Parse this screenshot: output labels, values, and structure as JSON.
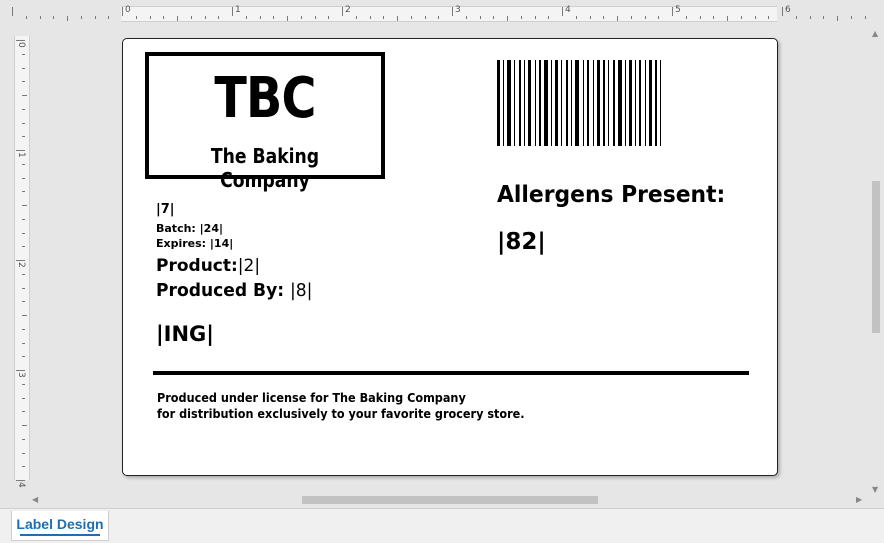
{
  "ruler": {
    "top_numbers": [
      "0",
      "1",
      "2",
      "3",
      "4",
      "5",
      "6"
    ],
    "left_numbers": [
      "0",
      "1",
      "2",
      "3",
      "4"
    ]
  },
  "label": {
    "logo_title": "TBC",
    "logo_subtitle": "The Baking Company",
    "field_7": "|7|",
    "batch": "Batch: |24|",
    "expires": "Expires: |14|",
    "product_label": "Product:",
    "product_value": "|2|",
    "produced_by_label": "Produced By: ",
    "produced_by_value": "|8|",
    "ing": "|ING|",
    "allergens_title": "Allergens Present:",
    "allergens_value": "|82|",
    "footer_line1": "Produced under license for The Baking Company",
    "footer_line2": "for distribution exclusively to your favorite grocery store."
  },
  "tabs": [
    {
      "label": "Label Design",
      "active": true
    }
  ],
  "colors": {
    "tab_accent": "#1f6fb0",
    "canvas_bg": "#e6e6e6"
  }
}
